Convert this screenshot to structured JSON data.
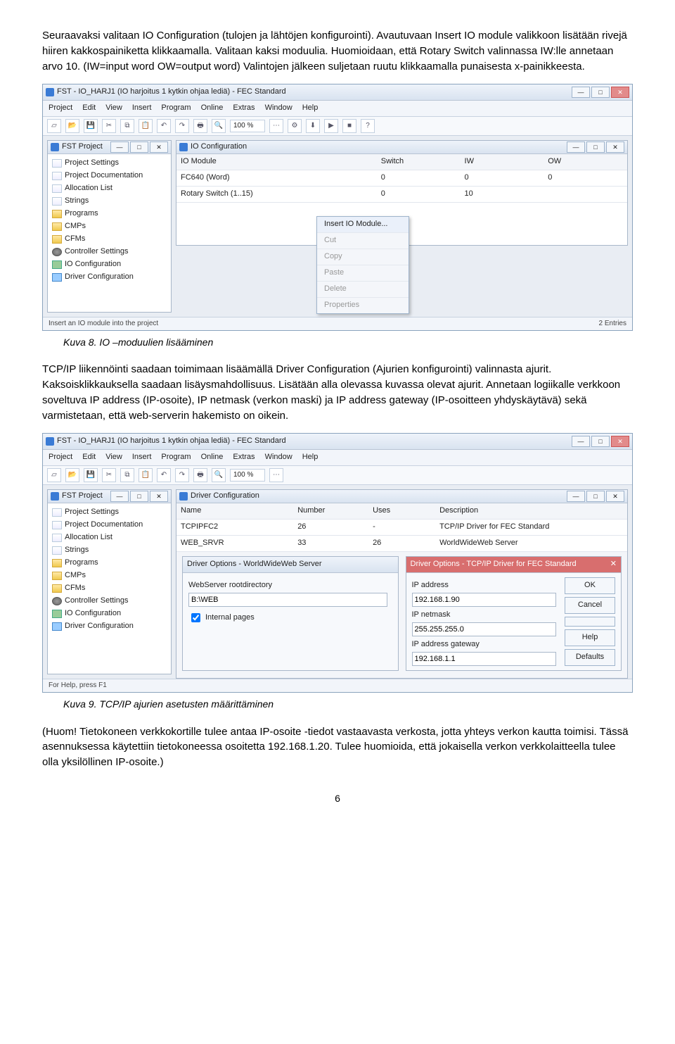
{
  "para1": "Seuraavaksi valitaan IO Configuration (tulojen ja lähtöjen konfigurointi). Avautuvaan Insert IO module valikkoon lisätään rivejä hiiren kakkospainiketta klikkaamalla. Valitaan kaksi moduulia. Huomioidaan, että Rotary Switch valinnassa IW:lle annetaan arvo 10. (IW=input word OW=output word) Valintojen jälkeen suljetaan ruutu klikkaamalla punaisesta x-painikkeesta.",
  "caption1": "Kuva 8. IO –moduulien lisääminen",
  "para2": "TCP/IP liikennöinti saadaan toimimaan lisäämällä Driver Configuration (Ajurien konfigurointi) valinnasta ajurit. Kaksoisklikkauksella saadaan lisäysmahdollisuus. Lisätään alla olevassa kuvassa olevat ajurit. Annetaan logiikalle verkkoon soveltuva IP address (IP-osoite), IP netmask (verkon maski) ja IP address gateway (IP-osoitteen yhdyskäytävä) sekä varmistetaan, että web-serverin hakemisto on oikein.",
  "caption2": "Kuva 9. TCP/IP ajurien asetusten määrittäminen",
  "para3": "(Huom! Tietokoneen verkkokortille tulee antaa IP-osoite -tiedot vastaavasta verkosta, jotta yhteys verkon kautta toimisi. Tässä asennuksessa käytettiin tietokoneessa osoitetta 192.168.1.20. Tulee huomioida, että jokaisella verkon verkkolaitteella tulee olla yksilöllinen IP-osoite.)",
  "pageNumber": "6",
  "shared": {
    "appTitle": "FST - IO_HARJ1 (IO harjoitus 1 kytkin ohjaa lediä) - FEC Standard",
    "menus": [
      "Project",
      "Edit",
      "View",
      "Insert",
      "Program",
      "Online",
      "Extras",
      "Window",
      "Help"
    ],
    "zoom": "100 %",
    "treeTitle": "FST Project",
    "treeItems": [
      {
        "label": "Project Settings",
        "icon": "ico-page"
      },
      {
        "label": "Project Documentation",
        "icon": "ico-page"
      },
      {
        "label": "Allocation List",
        "icon": "ico-page"
      },
      {
        "label": "Strings",
        "icon": "ico-page"
      },
      {
        "label": "Programs",
        "icon": "ico-folder"
      },
      {
        "label": "CMPs",
        "icon": "ico-folder"
      },
      {
        "label": "CFMs",
        "icon": "ico-folder"
      },
      {
        "label": "Controller Settings",
        "icon": "ico-gear"
      },
      {
        "label": "IO Configuration",
        "icon": "ico-chip"
      },
      {
        "label": "Driver Configuration",
        "icon": "ico-drv"
      }
    ],
    "winMin": "—",
    "winMax": "□",
    "winClose": "✕"
  },
  "shot1": {
    "innerTitle": "IO Configuration",
    "headers": [
      "IO Module",
      "Switch",
      "IW",
      "OW"
    ],
    "rows": [
      {
        "c1": "FC640 (Word)",
        "c2": "0",
        "c3": "0",
        "c4": "0"
      },
      {
        "c1": "Rotary Switch (1..15)",
        "c2": "0",
        "c3": "10",
        "c4": ""
      }
    ],
    "contextMenu": {
      "insert": "Insert IO Module...",
      "cut": "Cut",
      "copy": "Copy",
      "paste": "Paste",
      "delete": "Delete",
      "props": "Properties"
    },
    "statusLeft": "Insert an IO module into the project",
    "statusRight": "2 Entries"
  },
  "shot2": {
    "innerTitle": "Driver Configuration",
    "headers": [
      "Name",
      "Number",
      "Uses",
      "Description"
    ],
    "rows": [
      {
        "c1": "TCPIPFC2",
        "c2": "26",
        "c3": "-",
        "c4": "TCP/IP Driver for FEC Standard"
      },
      {
        "c1": "WEB_SRVR",
        "c2": "33",
        "c3": "26",
        "c4": "WorldWideWeb Server"
      }
    ],
    "dlgWeb": {
      "title": "Driver Options - WorldWideWeb Server",
      "lblRoot": "WebServer rootdirectory",
      "root": "B:\\WEB",
      "chkInternal": "Internal pages"
    },
    "dlgTcp": {
      "title": "Driver Options - TCP/IP Driver for FEC Standard",
      "lblIp": "IP address",
      "ip": "192.168.1.90",
      "lblMask": "IP netmask",
      "mask": "255.255.255.0",
      "lblGw": "IP address gateway",
      "gw": "192.168.1.1"
    },
    "btns": {
      "ok": "OK",
      "cancel": "Cancel",
      "help": "Help",
      "defaults": "Defaults"
    },
    "statusLeft": "For Help, press F1"
  }
}
